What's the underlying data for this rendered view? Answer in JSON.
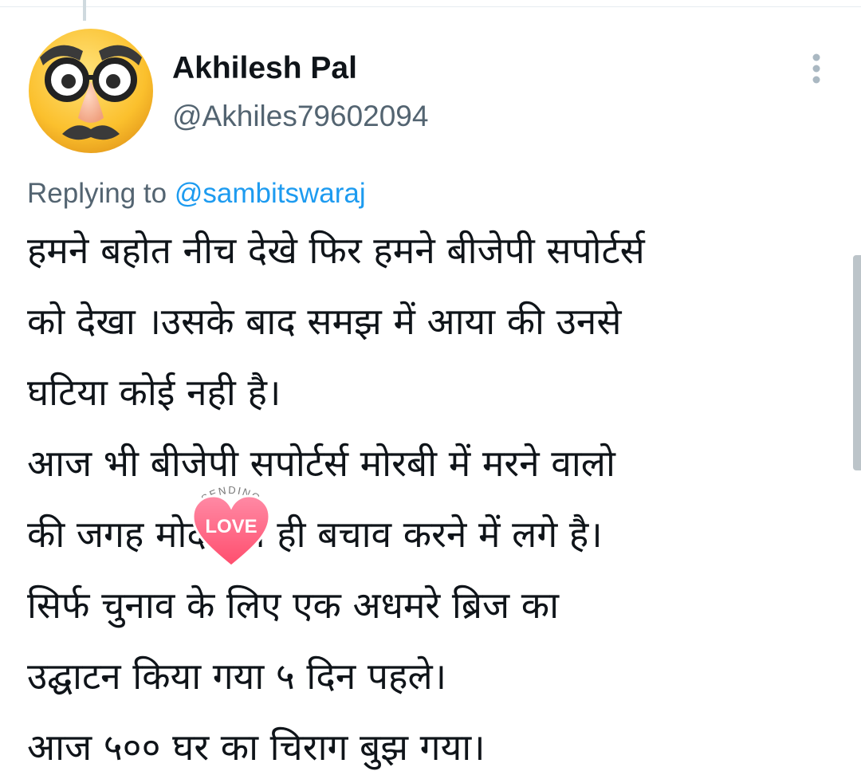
{
  "tweet": {
    "author": {
      "display_name": "Akhilesh Pal",
      "handle": "@Akhiles79602094",
      "avatar_icon": "disguise-face-emoji"
    },
    "reply_context": {
      "prefix": "Replying to",
      "mention": "@sambitswaraj"
    },
    "text_lines": [
      "हमने बहोत नीच देखे फिर हमने बीजेपी सपोर्टर्स",
      "को देखा ।उसके बाद समझ में आया की उनसे",
      "घटिया कोई नही है।",
      "आज भी बीजेपी सपोर्टर्स मोरबी में मरने वालो",
      "की जगह मोदी का ही बचाव करने में लगे है।",
      "सिर्फ चुनाव के लिए एक अधमरे ब्रिज का",
      "उद्घाटन किया गया ५ दिन पहले।",
      "आज ५०० घर का चिराग बुझ गया।"
    ],
    "sticker": {
      "top_text": "SENDING",
      "heart_text": "LOVE",
      "icon": "heart-icon"
    },
    "more_icon": "more-vertical-icon"
  },
  "colors": {
    "text_primary": "#0f1419",
    "text_secondary": "#536471",
    "link": "#1d9bf0",
    "heart": "#ff5a7a"
  }
}
